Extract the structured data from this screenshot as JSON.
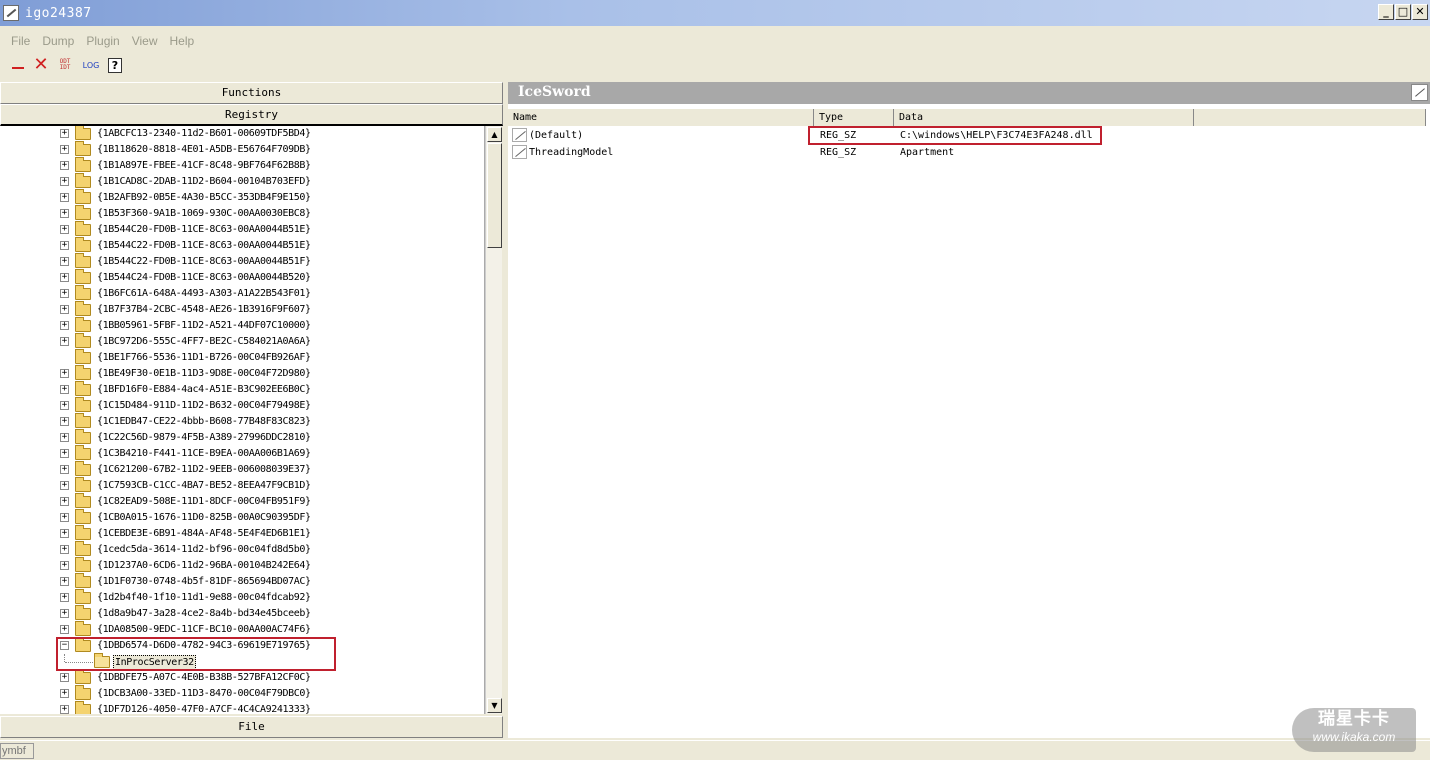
{
  "window": {
    "title": "igo24387",
    "min": "_",
    "max": "□",
    "close": "✕"
  },
  "menu": [
    "File",
    "Dump",
    "Plugin",
    "View",
    "Help"
  ],
  "toolbar": {
    "odt_label": "ODT IDT",
    "log_label": "LOG",
    "help_label": "?"
  },
  "left": {
    "functions_label": "Functions",
    "registry_label": "Registry",
    "file_label": "File",
    "tree_items": [
      {
        "label": "{1ABCFC13-2340-11d2-B601-00609TDF5BD4}",
        "exp": "+"
      },
      {
        "label": "{1B118620-8818-4E01-A5DB-E56764F709DB}",
        "exp": "+"
      },
      {
        "label": "{1B1A897E-FBEE-41CF-8C48-9BF764F62B8B}",
        "exp": "+"
      },
      {
        "label": "{1B1CAD8C-2DAB-11D2-B604-00104B703EFD}",
        "exp": "+"
      },
      {
        "label": "{1B2AFB92-0B5E-4A30-B5CC-353DB4F9E150}",
        "exp": "+"
      },
      {
        "label": "{1B53F360-9A1B-1069-930C-00AA0030EBC8}",
        "exp": "+"
      },
      {
        "label": "{1B544C20-FD0B-11CE-8C63-00AA0044B51E}",
        "exp": "+"
      },
      {
        "label": "{1B544C22-FD0B-11CE-8C63-00AA0044B51E}",
        "exp": "+"
      },
      {
        "label": "{1B544C22-FD0B-11CE-8C63-00AA0044B51F}",
        "exp": "+"
      },
      {
        "label": "{1B544C24-FD0B-11CE-8C63-00AA0044B520}",
        "exp": "+"
      },
      {
        "label": "{1B6FC61A-648A-4493-A303-A1A22B543F01}",
        "exp": "+"
      },
      {
        "label": "{1B7F37B4-2CBC-4548-AE26-1B3916F9F607}",
        "exp": "+"
      },
      {
        "label": "{1BB05961-5FBF-11D2-A521-44DF07C10000}",
        "exp": "+"
      },
      {
        "label": "{1BC972D6-555C-4FF7-BE2C-C584021A0A6A}",
        "exp": "+"
      },
      {
        "label": "{1BE1F766-5536-11D1-B726-00C04FB926AF}",
        "exp": ""
      },
      {
        "label": "{1BE49F30-0E1B-11D3-9D8E-00C04F72D980}",
        "exp": "+"
      },
      {
        "label": "{1BFD16F0-E884-4ac4-A51E-B3C902EE6B0C}",
        "exp": "+"
      },
      {
        "label": "{1C15D484-911D-11D2-B632-00C04F79498E}",
        "exp": "+"
      },
      {
        "label": "{1C1EDB47-CE22-4bbb-B608-77B48F83C823}",
        "exp": "+"
      },
      {
        "label": "{1C22C56D-9879-4F5B-A389-27996DDC2810}",
        "exp": "+"
      },
      {
        "label": "{1C3B4210-F441-11CE-B9EA-00AA006B1A69}",
        "exp": "+"
      },
      {
        "label": "{1C621200-67B2-11D2-9EEB-006008039E37}",
        "exp": "+"
      },
      {
        "label": "{1C7593CB-C1CC-4BA7-BE52-8EEA47F9CB1D}",
        "exp": "+"
      },
      {
        "label": "{1C82EAD9-508E-11D1-8DCF-00C04FB951F9}",
        "exp": "+"
      },
      {
        "label": "{1CB0A015-1676-11D0-825B-00A0C90395DF}",
        "exp": "+"
      },
      {
        "label": "{1CEBDE3E-6B91-484A-AF48-5E4F4ED6B1E1}",
        "exp": "+"
      },
      {
        "label": "{1cedc5da-3614-11d2-bf96-00c04fd8d5b0}",
        "exp": "+"
      },
      {
        "label": "{1D1237A0-6CD6-11d2-96BA-00104B242E64}",
        "exp": "+"
      },
      {
        "label": "{1D1F0730-0748-4b5f-81DF-865694BD07AC}",
        "exp": "+"
      },
      {
        "label": "{1d2b4f40-1f10-11d1-9e88-00c04fdcab92}",
        "exp": "+"
      },
      {
        "label": "{1d8a9b47-3a28-4ce2-8a4b-bd34e45bceeb}",
        "exp": "+"
      },
      {
        "label": "{1DA08500-9EDC-11CF-BC10-00AA00AC74F6}",
        "exp": "+"
      },
      {
        "label": "{1DBD6574-D6D0-4782-94C3-69619E719765}",
        "exp": "−"
      },
      {
        "label": "InProcServer32",
        "exp": "",
        "child": true
      },
      {
        "label": "{1DBDFE75-A07C-4E0B-B38B-527BFA12CF0C}",
        "exp": "+"
      },
      {
        "label": "{1DCB3A00-33ED-11D3-8470-00C04F79DBC0}",
        "exp": "+"
      },
      {
        "label": "{1DF7D126-4050-47F0-A7CF-4C4CA9241333}",
        "exp": "+"
      }
    ]
  },
  "right": {
    "panel_title": "IceSword",
    "columns": [
      "Name",
      "Type",
      "Data"
    ],
    "rows": [
      {
        "name": "(Default)",
        "type": "REG_SZ",
        "data": "C:\\windows\\HELP\\F3C74E3FA248.dll"
      },
      {
        "name": "ThreadingModel",
        "type": "REG_SZ",
        "data": "Apartment"
      }
    ]
  },
  "status": {
    "text": "ymbf"
  },
  "watermark": {
    "main": "瑞星卡卡",
    "sub": "www.ikaka.com"
  }
}
